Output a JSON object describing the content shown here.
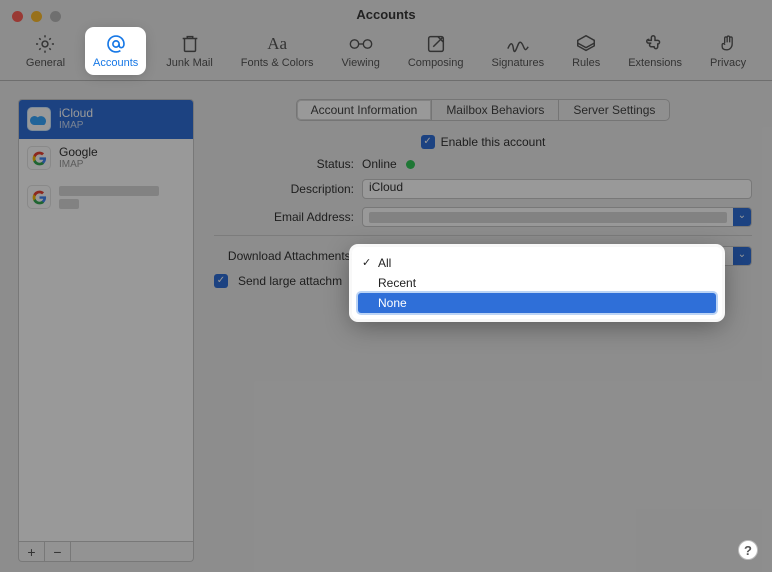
{
  "window": {
    "title": "Accounts"
  },
  "toolbar": {
    "items": [
      {
        "label": "General"
      },
      {
        "label": "Accounts"
      },
      {
        "label": "Junk Mail"
      },
      {
        "label": "Fonts & Colors"
      },
      {
        "label": "Viewing"
      },
      {
        "label": "Composing"
      },
      {
        "label": "Signatures"
      },
      {
        "label": "Rules"
      },
      {
        "label": "Extensions"
      },
      {
        "label": "Privacy"
      }
    ]
  },
  "sidebar": {
    "accounts": [
      {
        "name": "iCloud",
        "protocol": "IMAP",
        "icon": "cloud"
      },
      {
        "name": "Google",
        "protocol": "IMAP",
        "icon": "google"
      },
      {
        "name": "",
        "protocol": "",
        "icon": "google"
      }
    ],
    "add_label": "+",
    "remove_label": "−"
  },
  "tabs": {
    "items": [
      {
        "label": "Account Information"
      },
      {
        "label": "Mailbox Behaviors"
      },
      {
        "label": "Server Settings"
      }
    ]
  },
  "form": {
    "enable_label": "Enable this account",
    "status_label": "Status:",
    "status_value": "Online",
    "description_label": "Description:",
    "description_value": "iCloud",
    "email_label": "Email Address:",
    "download_label": "Download Attachments:",
    "send_large_label": "Send large attachm"
  },
  "dropdown": {
    "items": [
      {
        "label": "All",
        "checked": true
      },
      {
        "label": "Recent"
      },
      {
        "label": "None",
        "hovered": true
      }
    ]
  },
  "help_label": "?"
}
